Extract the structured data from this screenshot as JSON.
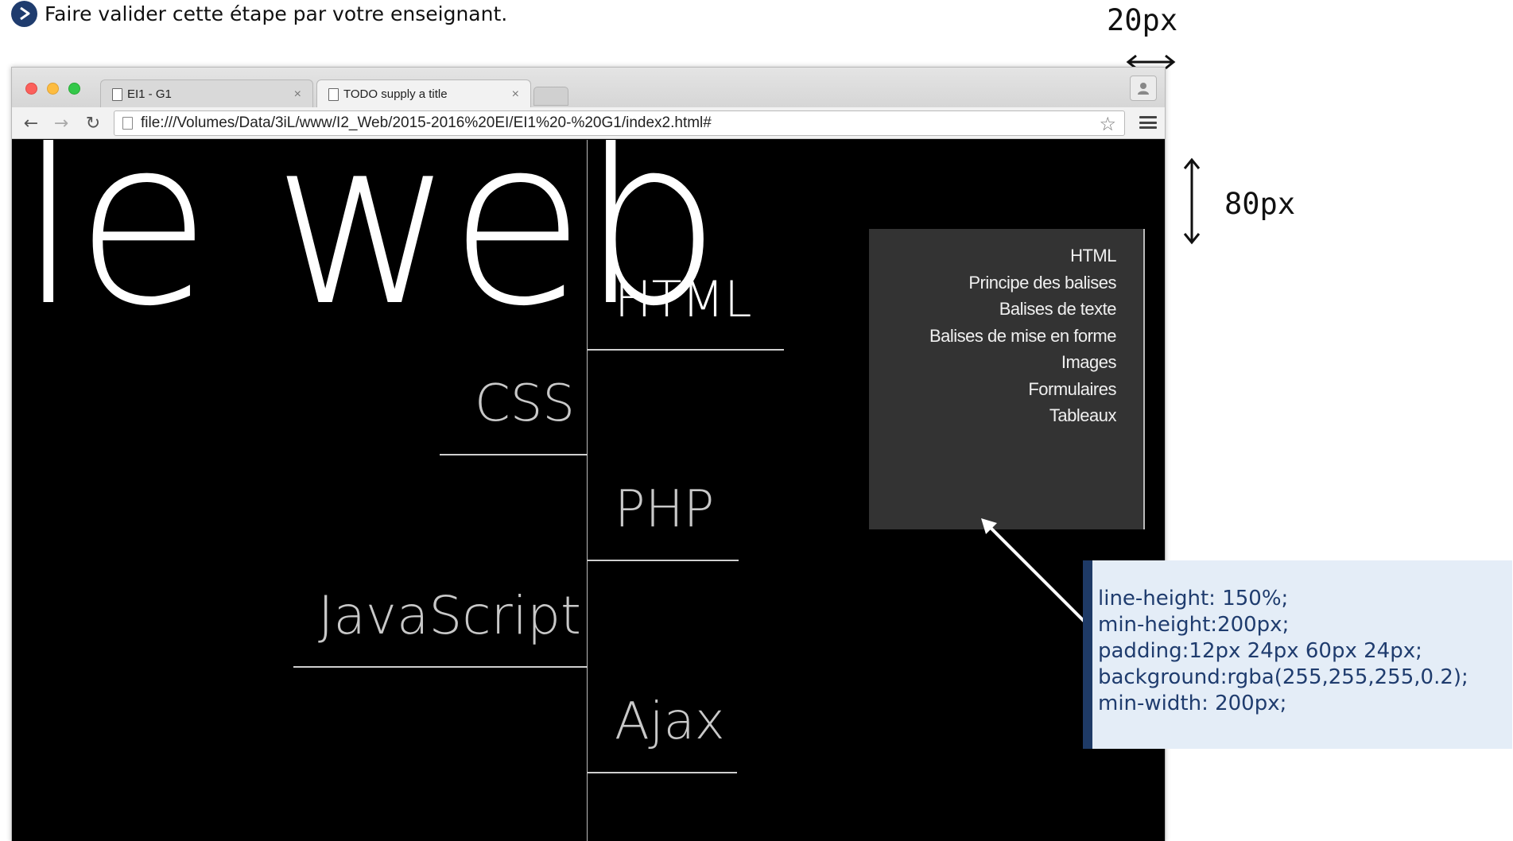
{
  "instruction": {
    "text": "Faire valider cette étape par votre enseignant."
  },
  "annotations": {
    "width_label": "20px",
    "height_label": "80px"
  },
  "browser": {
    "tabs": [
      {
        "title": "EI1 - G1",
        "close": "×"
      },
      {
        "title": "TODO supply a title",
        "close": "×"
      }
    ],
    "url": "file:///Volumes/Data/3iL/www/I2_Web/2015-2016%20EI/EI1%20-%20G1/index2.html#",
    "star": "☆",
    "nav": {
      "back": "←",
      "forward": "→",
      "reload": "↻"
    }
  },
  "page": {
    "title": "le web",
    "menu": [
      "HTML",
      "CSS",
      "PHP",
      "JavaScript",
      "Ajax"
    ],
    "submenu": [
      "HTML",
      "Principe des balises",
      "Balises de texte",
      "Balises de mise en forme",
      "Images",
      "Formulaires",
      "Tableaux"
    ]
  },
  "callout": {
    "lines": [
      "line-height: 150%;",
      "min-height:200px;",
      "padding:12px 24px 60px 24px;",
      "background:rgba(255,255,255,0.2);",
      "min-width: 200px;"
    ]
  },
  "colors": {
    "bullet": "#1f3c6e",
    "callout_bg": "#e4edf7",
    "callout_bar": "#1e3a66",
    "submenu_bg": "#333333"
  }
}
